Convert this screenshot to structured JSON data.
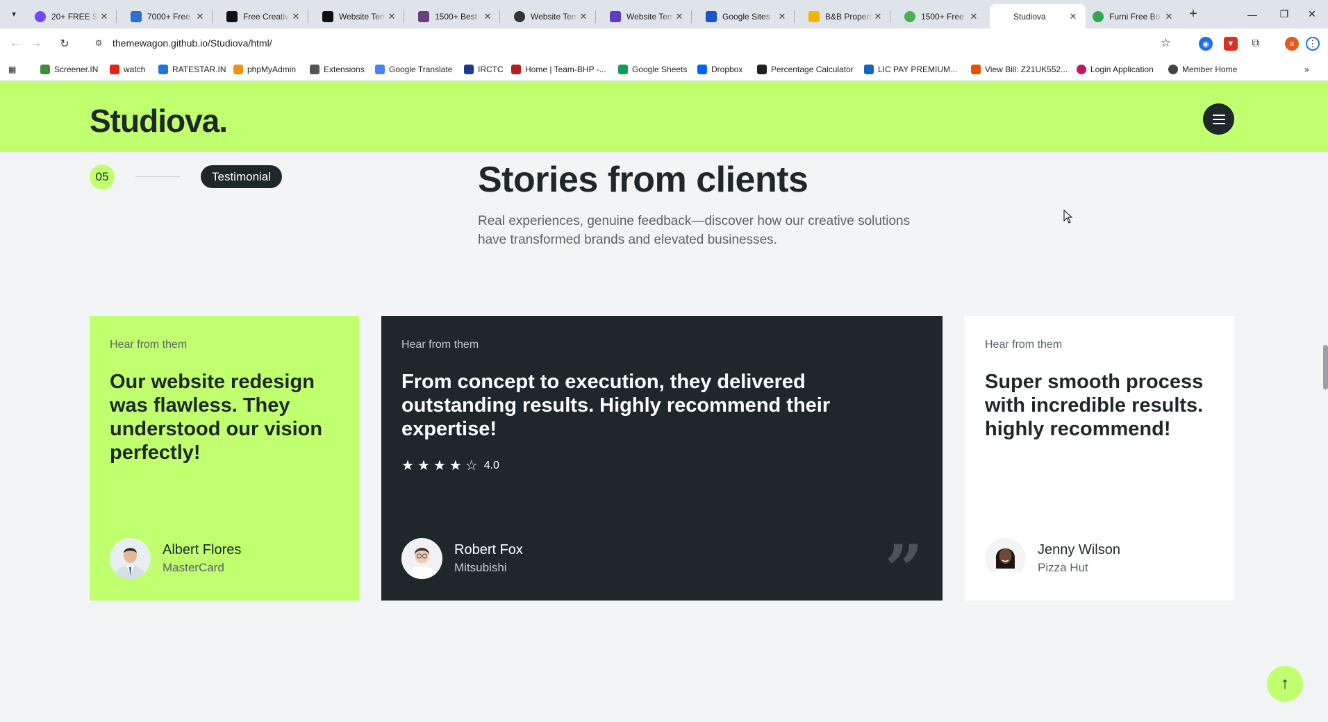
{
  "browser": {
    "tabs": [
      {
        "label": "20+ FREE Se",
        "color": "#6d4aff"
      },
      {
        "label": "7000+ Free",
        "color": "#2b6fd6"
      },
      {
        "label": "Free Creative",
        "color": "#111111"
      },
      {
        "label": "Website Tem",
        "color": "#111111"
      },
      {
        "label": "1500+ Best",
        "color": "#6b3f7c"
      },
      {
        "label": "Website Tem",
        "color": "#333333"
      },
      {
        "label": "Website Tem",
        "color": "#5b3cc4"
      },
      {
        "label": "Google Sites",
        "color": "#1a57c6"
      },
      {
        "label": "B&B Propert",
        "color": "#f2b705"
      },
      {
        "label": "1500+ Free",
        "color": "#4caf50"
      },
      {
        "label": "Studiova",
        "color": "#ffffff"
      },
      {
        "label": "Furni Free Bo",
        "color": "#2fa84f"
      }
    ],
    "url": "themewagon.github.io/Studiova/html/",
    "bookmarks": [
      {
        "label": "Screener.IN",
        "color": "#3f8e3f"
      },
      {
        "label": "watch",
        "color": "#e62117"
      },
      {
        "label": "RATESTAR.IN",
        "color": "#1b74e4"
      },
      {
        "label": "phpMyAdmin",
        "color": "#f29111"
      },
      {
        "label": "Extensions",
        "color": "#555555"
      },
      {
        "label": "Google Translate",
        "color": "#4285f4"
      },
      {
        "label": "IRCTC",
        "color": "#1e3a8a"
      },
      {
        "label": "Home | Team-BHP -...",
        "color": "#b71c1c"
      },
      {
        "label": "Google Sheets",
        "color": "#0f9d58"
      },
      {
        "label": "Dropbox",
        "color": "#0061fe"
      },
      {
        "label": "Percentage Calculator",
        "color": "#222222"
      },
      {
        "label": "LIC PAY PREMIUM...",
        "color": "#1565c0"
      },
      {
        "label": "View Bill: Z21UK552...",
        "color": "#e65100"
      },
      {
        "label": "Login Application",
        "color": "#c2185b"
      },
      {
        "label": "Member Home",
        "color": "#444444"
      }
    ],
    "profile_initial": "a"
  },
  "site": {
    "logo": "Studiova.",
    "section_number": "05",
    "section_badge": "Testimonial",
    "title": "Stories from clients",
    "description": "Real experiences, genuine feedback—discover how our creative solutions have transformed brands and elevated businesses."
  },
  "testimonials": [
    {
      "eyebrow": "Hear from them",
      "quote": "Our website redesign was flawless. They understood our vision perfectly!",
      "name": "Albert Flores",
      "company": "MasterCard"
    },
    {
      "eyebrow": "Hear from them",
      "quote": "From concept to execution, they delivered outstanding results. Highly recommend their expertise!",
      "rating": 4,
      "rating_label": "4.0",
      "name": "Robert Fox",
      "company": "Mitsubishi"
    },
    {
      "eyebrow": "Hear from them",
      "quote": "Super smooth process with incredible results. highly recommend!",
      "name": "Jenny Wilson",
      "company": "Pizza Hut"
    }
  ],
  "colors": {
    "accent": "#c0ff6e",
    "dark": "#1f272b"
  }
}
